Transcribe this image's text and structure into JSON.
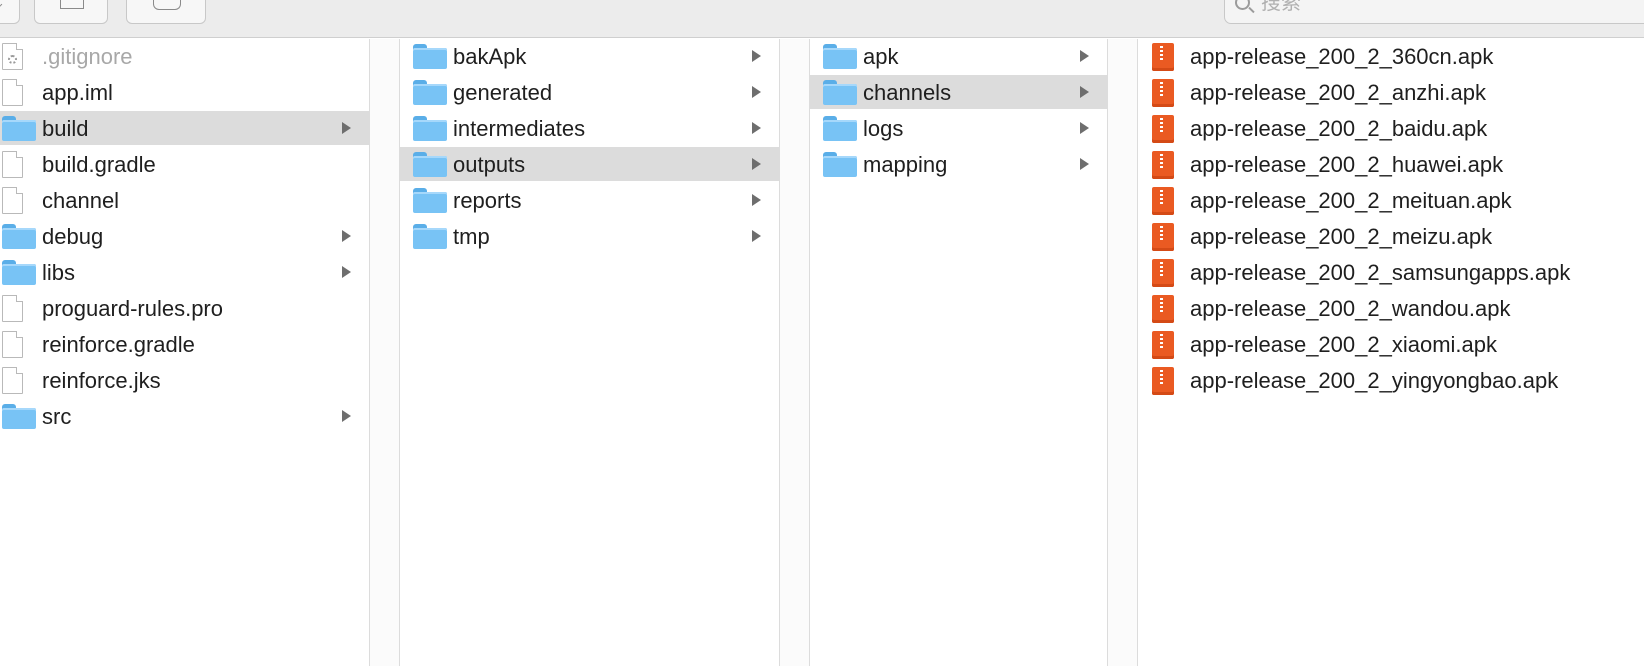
{
  "toolbar": {
    "search_placeholder": "搜索"
  },
  "columns": [
    {
      "items": [
        {
          "name": ".gitignore",
          "kind": "file-gear",
          "dim": true
        },
        {
          "name": "app.iml",
          "kind": "file"
        },
        {
          "name": "build",
          "kind": "folder",
          "selected": true
        },
        {
          "name": "build.gradle",
          "kind": "file"
        },
        {
          "name": "channel",
          "kind": "file"
        },
        {
          "name": "debug",
          "kind": "folder"
        },
        {
          "name": "libs",
          "kind": "folder"
        },
        {
          "name": "proguard-rules.pro",
          "kind": "file"
        },
        {
          "name": "reinforce.gradle",
          "kind": "file"
        },
        {
          "name": "reinforce.jks",
          "kind": "file"
        },
        {
          "name": "src",
          "kind": "folder"
        }
      ]
    },
    {
      "items": [
        {
          "name": "bakApk",
          "kind": "folder"
        },
        {
          "name": "generated",
          "kind": "folder"
        },
        {
          "name": "intermediates",
          "kind": "folder"
        },
        {
          "name": "outputs",
          "kind": "folder",
          "selected": true
        },
        {
          "name": "reports",
          "kind": "folder"
        },
        {
          "name": "tmp",
          "kind": "folder"
        }
      ]
    },
    {
      "items": [
        {
          "name": "apk",
          "kind": "folder"
        },
        {
          "name": "channels",
          "kind": "folder",
          "selected": true
        },
        {
          "name": "logs",
          "kind": "folder"
        },
        {
          "name": "mapping",
          "kind": "folder"
        }
      ]
    },
    {
      "items": [
        {
          "name": "app-release_200_2_360cn.apk",
          "kind": "apk"
        },
        {
          "name": "app-release_200_2_anzhi.apk",
          "kind": "apk"
        },
        {
          "name": "app-release_200_2_baidu.apk",
          "kind": "apk"
        },
        {
          "name": "app-release_200_2_huawei.apk",
          "kind": "apk"
        },
        {
          "name": "app-release_200_2_meituan.apk",
          "kind": "apk"
        },
        {
          "name": "app-release_200_2_meizu.apk",
          "kind": "apk"
        },
        {
          "name": "app-release_200_2_samsungapps.apk",
          "kind": "apk"
        },
        {
          "name": "app-release_200_2_wandou.apk",
          "kind": "apk"
        },
        {
          "name": "app-release_200_2_xiaomi.apk",
          "kind": "apk"
        },
        {
          "name": "app-release_200_2_yingyongbao.apk",
          "kind": "apk"
        }
      ]
    }
  ],
  "colors": {
    "selection": "#dcdcdc",
    "folder": "#78c3f5",
    "apk": "#ea5a22"
  }
}
